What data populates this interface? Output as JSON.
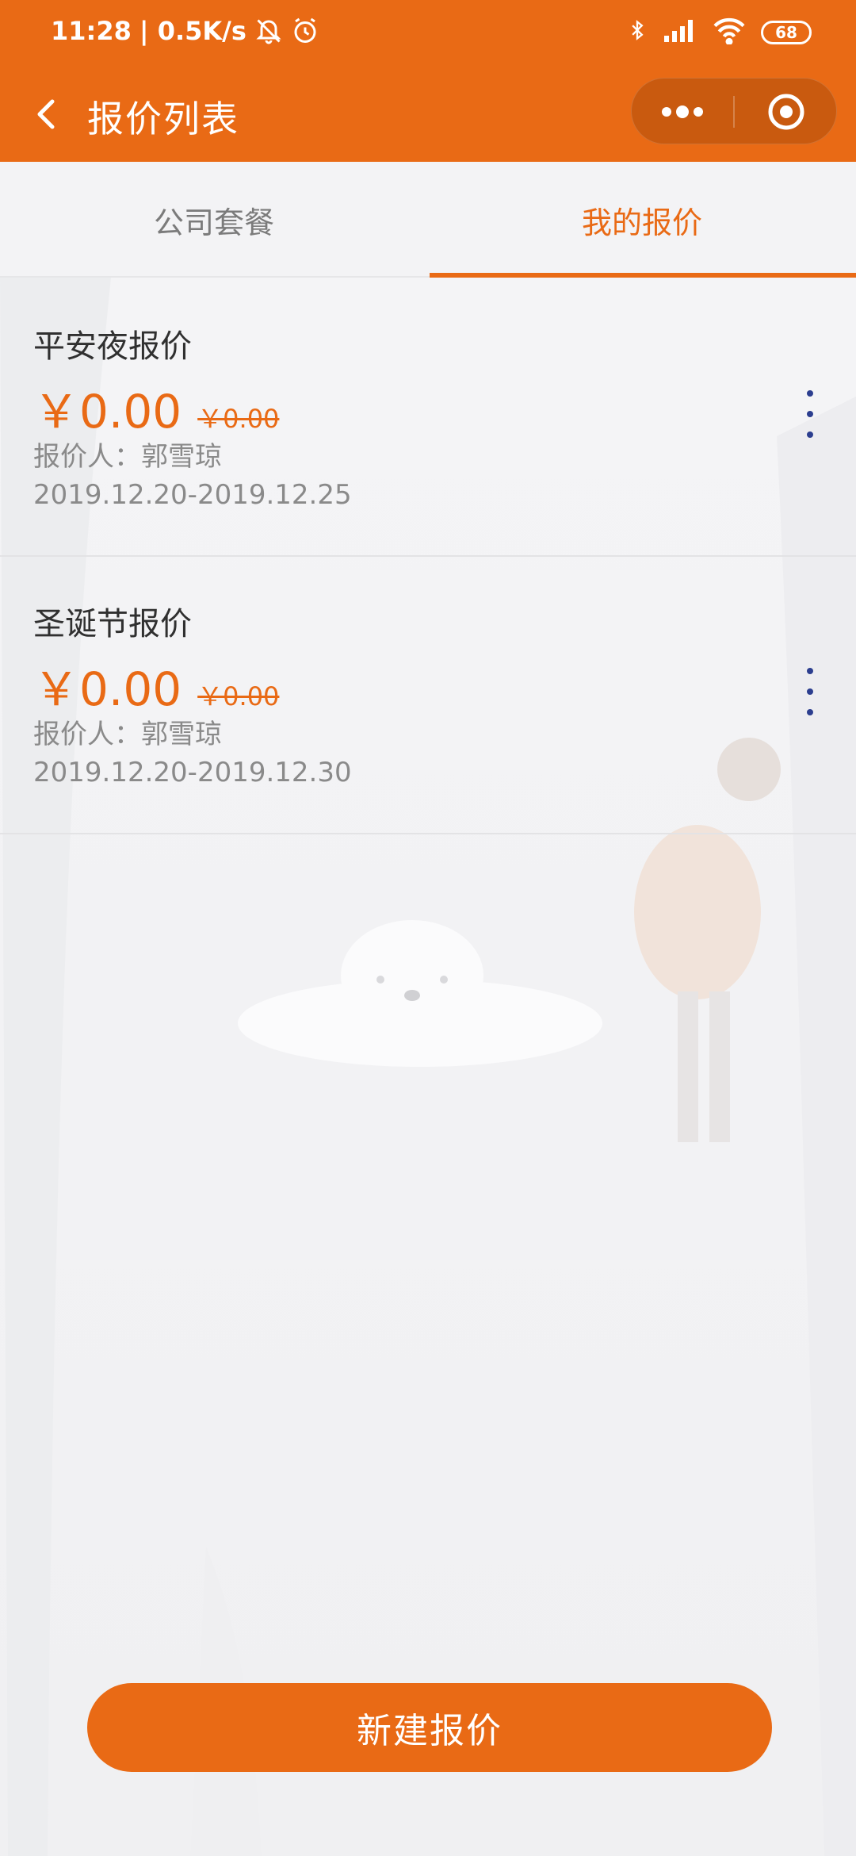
{
  "status_bar": {
    "time": "11:28",
    "speed": "| 0.5K/s",
    "battery": "68"
  },
  "nav": {
    "title": "报价列表"
  },
  "tabs": [
    {
      "label": "公司套餐",
      "active": false
    },
    {
      "label": "我的报价",
      "active": true
    }
  ],
  "quotes": [
    {
      "title": "平安夜报价",
      "price": "￥0.00",
      "original_price": "￥0.00",
      "person": "报价人：郭雪琼",
      "dates": "2019.12.20-2019.12.25"
    },
    {
      "title": "圣诞节报价",
      "price": "￥0.00",
      "original_price": "￥0.00",
      "person": "报价人：郭雪琼",
      "dates": "2019.12.20-2019.12.30"
    }
  ],
  "actions": {
    "new_quote_label": "新建报价"
  },
  "colors": {
    "accent": "#e96a15",
    "background": "#f4f4f6",
    "menu_dots": "#2c3e8f"
  },
  "icons": [
    "chevron-left-icon",
    "more-dots-icon",
    "record-circle-icon",
    "bluetooth-icon",
    "signal-icon",
    "wifi-icon",
    "battery-icon",
    "mute-bell-icon",
    "alarm-icon",
    "vertical-more-icon"
  ]
}
